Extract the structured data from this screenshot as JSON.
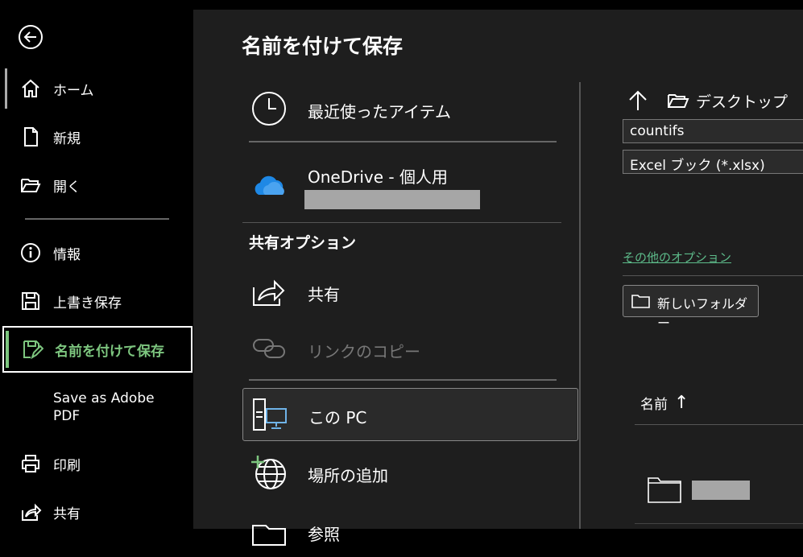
{
  "sidebar": {
    "items": [
      {
        "label": "ホーム",
        "icon": "home-icon"
      },
      {
        "label": "新規",
        "icon": "new-document-icon"
      },
      {
        "label": "開く",
        "icon": "open-folder-icon"
      },
      {
        "label": "情報",
        "icon": "info-icon"
      },
      {
        "label": "上書き保存",
        "icon": "save-icon"
      },
      {
        "label": "名前を付けて保存",
        "icon": "save-as-icon"
      },
      {
        "label": "Save as Adobe PDF",
        "icon": ""
      },
      {
        "label": "印刷",
        "icon": "printer-icon"
      },
      {
        "label": "共有",
        "icon": "share-icon"
      }
    ]
  },
  "page": {
    "title": "名前を付けて保存"
  },
  "locations": {
    "recent": "最近使ったアイテム",
    "onedrive": "OneDrive - 個人用",
    "shared_header": "共有オプション",
    "share": "共有",
    "copy_link": "リンクのコピー",
    "this_pc": "この PC",
    "add_place": "場所の追加",
    "browse": "参照"
  },
  "save_panel": {
    "current_folder": "デスクトップ",
    "filename": "countifs",
    "filetype": "Excel ブック (*.xlsx)",
    "more_options": "その他のオプション",
    "new_folder": "新しいフォルダー",
    "column_name": "名前",
    "sort_arrow": "↑"
  },
  "colors": {
    "accent": "#7dc67f",
    "link": "#5dbb8a",
    "onedrive": "#1e88e5"
  }
}
